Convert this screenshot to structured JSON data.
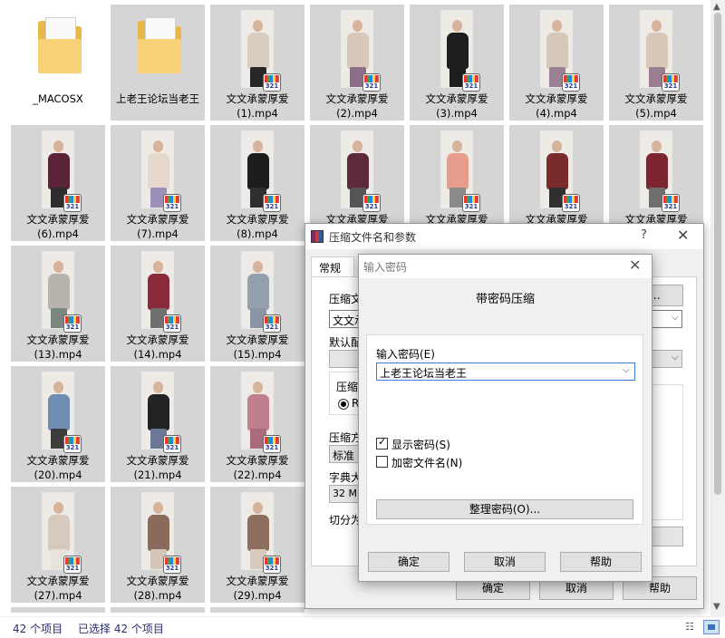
{
  "explorer": {
    "rows": [
      [
        {
          "kind": "folder",
          "label": "_MACOSX"
        },
        {
          "kind": "folder",
          "label": "上老王论坛当老王"
        },
        {
          "kind": "video",
          "label": "文文承蒙厚爱(1).mp4",
          "top": "#d9cdbf",
          "bottom": "#262626"
        },
        {
          "kind": "video",
          "label": "文文承蒙厚爱(2).mp4",
          "top": "#d8c8ba",
          "bottom": "#8c6e86"
        },
        {
          "kind": "video",
          "label": "文文承蒙厚爱(3).mp4",
          "top": "#1e1e1e",
          "bottom": "#1e1e1e"
        },
        {
          "kind": "video",
          "label": "文文承蒙厚爱(4).mp4",
          "top": "#d6c8b8",
          "bottom": "#9b7f92"
        },
        {
          "kind": "video",
          "label": "文文承蒙厚爱(5).mp4",
          "top": "#d8c8b8",
          "bottom": "#987e8e"
        }
      ],
      [
        {
          "kind": "video",
          "label": "文文承蒙厚爱(6).mp4",
          "top": "#5a2338",
          "bottom": "#2d2d2d"
        },
        {
          "kind": "video",
          "label": "文文承蒙厚爱(7).mp4",
          "top": "#e7d8ce",
          "bottom": "#9d8fb8"
        },
        {
          "kind": "video",
          "label": "文文承蒙厚爱(8).mp4",
          "top": "#1d1d1d",
          "bottom": "#2f2f2f"
        },
        {
          "kind": "video",
          "label": "文文承蒙厚爱",
          "top": "#5c2a3b",
          "bottom": "#555555"
        },
        {
          "kind": "video",
          "label": "文文承蒙厚爱",
          "top": "#e69d8b",
          "bottom": "#8a8a8a"
        },
        {
          "kind": "video",
          "label": "文文承蒙厚爱",
          "top": "#7a2c2c",
          "bottom": "#303030"
        },
        {
          "kind": "video",
          "label": "文文承蒙厚爱",
          "top": "#7d2530",
          "bottom": "#6e6e6e"
        }
      ],
      [
        {
          "kind": "video",
          "label": "文文承蒙厚爱(13).mp4",
          "top": "#b9b3ae",
          "bottom": "#7b8680"
        },
        {
          "kind": "video",
          "label": "文文承蒙厚爱(14).mp4",
          "top": "#8a2a3a",
          "bottom": "#707070"
        },
        {
          "kind": "video",
          "label": "文文承蒙厚爱(15).mp4",
          "top": "#94a0ae",
          "bottom": "#8b95a5"
        }
      ],
      [
        {
          "kind": "video",
          "label": "文文承蒙厚爱(20).mp4",
          "top": "#6f8cb3",
          "bottom": "#3d3d3d"
        },
        {
          "kind": "video",
          "label": "文文承蒙厚爱(21).mp4",
          "top": "#222222",
          "bottom": "#6a7896"
        },
        {
          "kind": "video",
          "label": "文文承蒙厚爱(22).mp4",
          "top": "#c07f8c",
          "bottom": "#a86c7b"
        }
      ],
      [
        {
          "kind": "video",
          "label": "文文承蒙厚爱(27).mp4",
          "top": "#d6c9bd",
          "bottom": "#e8e2dc"
        },
        {
          "kind": "video",
          "label": "文文承蒙厚爱(28).mp4",
          "top": "#8a6a5a",
          "bottom": "#d3c6b9"
        },
        {
          "kind": "video",
          "label": "文文承蒙厚爱(29).mp4",
          "top": "#8e6e5e",
          "bottom": "#d7c9bc"
        }
      ]
    ],
    "status": {
      "item_count": "42 个项目",
      "selected": "已选择 42 个项目"
    }
  },
  "archive_dialog": {
    "title": "压缩文件名和参数",
    "help": "?",
    "close": "✕",
    "tab_general": "常规",
    "archive_name_label": "压缩文",
    "archive_name_value": "文文承",
    "browse_button": "(B)...",
    "default_profile_label": "默认配",
    "format_group_label": "压缩",
    "format_option": "RA",
    "method_label": "压缩方",
    "method_value": "标准",
    "dict_label": "字典大",
    "dict_value": "32 MB",
    "split_label": "切分为",
    "ok_button": "确定",
    "cancel_button": "取消",
    "help_button": "帮助"
  },
  "password_dialog": {
    "title": "输入密码",
    "close": "✕",
    "heading": "带密码压缩",
    "password_label": "输入密码(E)",
    "password_value": "上老王论坛当老王",
    "show_password_label": "显示密码(S)",
    "show_password_checked": true,
    "encrypt_names_label": "加密文件名(N)",
    "encrypt_names_checked": false,
    "organize_button": "整理密码(O)...",
    "ok_button": "确定",
    "cancel_button": "取消",
    "help_button": "帮助"
  },
  "icons": {
    "mpc_badge_text": "321",
    "scroll_up": "▲",
    "scroll_down": "▼",
    "chevron": "⌵",
    "details_view": "☷"
  }
}
